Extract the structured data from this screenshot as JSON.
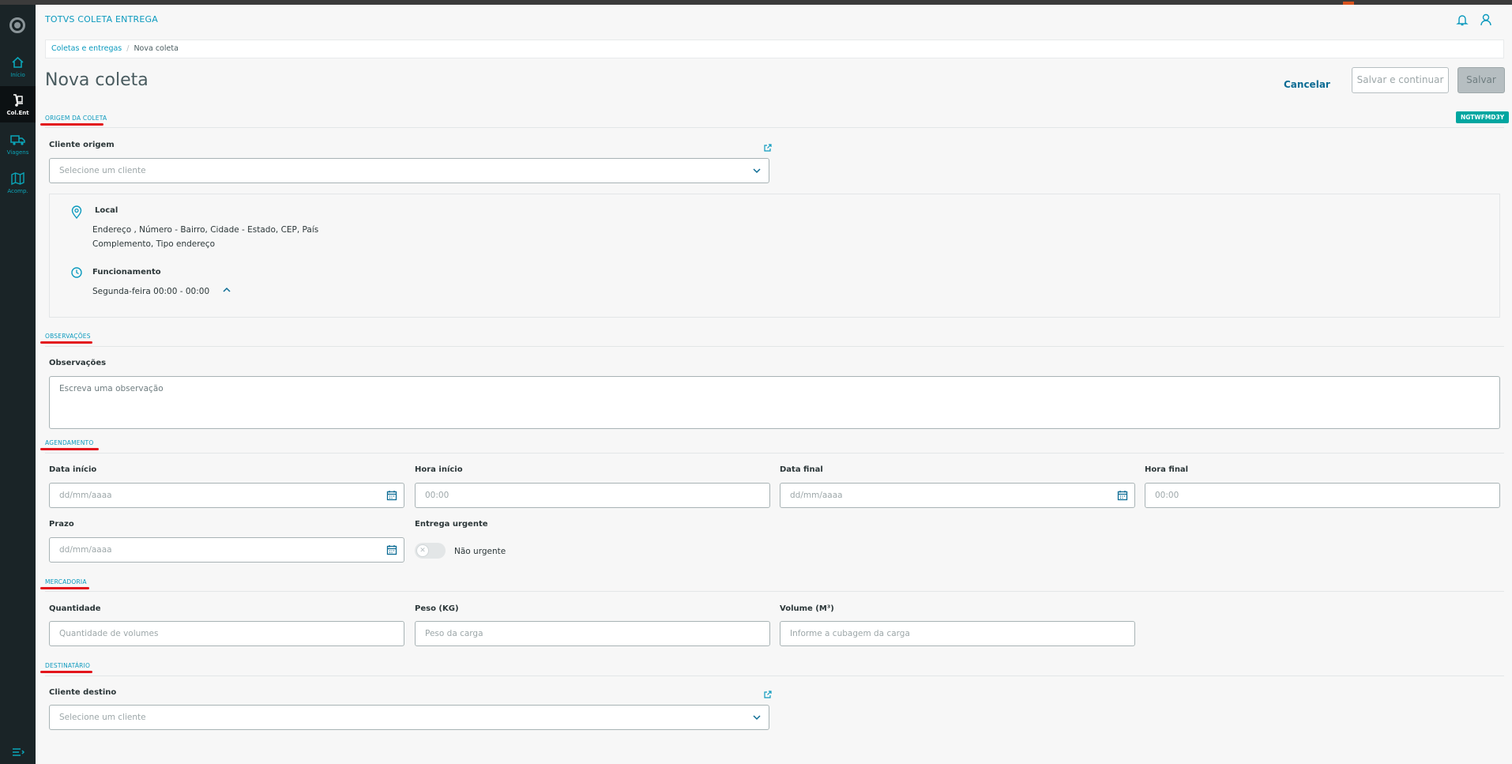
{
  "app": {
    "title": "TOTVS COLETA ENTREGA"
  },
  "sidebar": {
    "items": [
      {
        "label": "Início",
        "icon": "home-icon"
      },
      {
        "label": "Col.Ent",
        "icon": "hand-truck-icon"
      },
      {
        "label": "Viagens",
        "icon": "truck-icon"
      },
      {
        "label": "Acomp.",
        "icon": "map-icon"
      }
    ]
  },
  "breadcrumb": {
    "parent": "Coletas e entregas",
    "current": "Nova coleta"
  },
  "page": {
    "title": "Nova coleta"
  },
  "actions": {
    "cancel": "Cancelar",
    "save_continue": "Salvar e continuar",
    "save": "Salvar"
  },
  "origin": {
    "section_title": "ORIGEM DA COLETA",
    "badge": "NGTWFMD3Y",
    "client_label": "Cliente origem",
    "client_placeholder": "Selecione um cliente",
    "local_label": "Local",
    "address_line1": "Endereço , Número - Bairro, Cidade - Estado, CEP, País",
    "address_line2": "Complemento, Tipo endereço",
    "hours_label": "Funcionamento",
    "hours_value": "Segunda-feira 00:00 - 00:00"
  },
  "observations": {
    "section_title": "OBSERVAÇÕES",
    "label": "Observações",
    "placeholder": "Escreva uma observação"
  },
  "scheduling": {
    "section_title": "AGENDAMENTO",
    "start_date_label": "Data início",
    "start_date_placeholder": "dd/mm/aaaa",
    "start_time_label": "Hora início",
    "start_time_placeholder": "00:00",
    "end_date_label": "Data final",
    "end_date_placeholder": "dd/mm/aaaa",
    "end_time_label": "Hora final",
    "end_time_placeholder": "00:00",
    "deadline_label": "Prazo",
    "deadline_placeholder": "dd/mm/aaaa",
    "urgent_label": "Entrega urgente",
    "urgent_value": "Não urgente"
  },
  "goods": {
    "section_title": "MERCADORIA",
    "quantity_label": "Quantidade",
    "quantity_placeholder": "Quantidade de volumes",
    "weight_label": "Peso (KG)",
    "weight_placeholder": "Peso da carga",
    "volume_label": "Volume (M³)",
    "volume_placeholder": "Informe a cubagem da carga"
  },
  "recipient": {
    "section_title": "DESTINATÁRIO",
    "client_label": "Cliente destino",
    "client_placeholder": "Selecione um cliente"
  },
  "colors": {
    "accent": "#0c9abe",
    "sidebar": "#1a2427",
    "badge": "#00a6a0",
    "underline": "#e3151c"
  }
}
